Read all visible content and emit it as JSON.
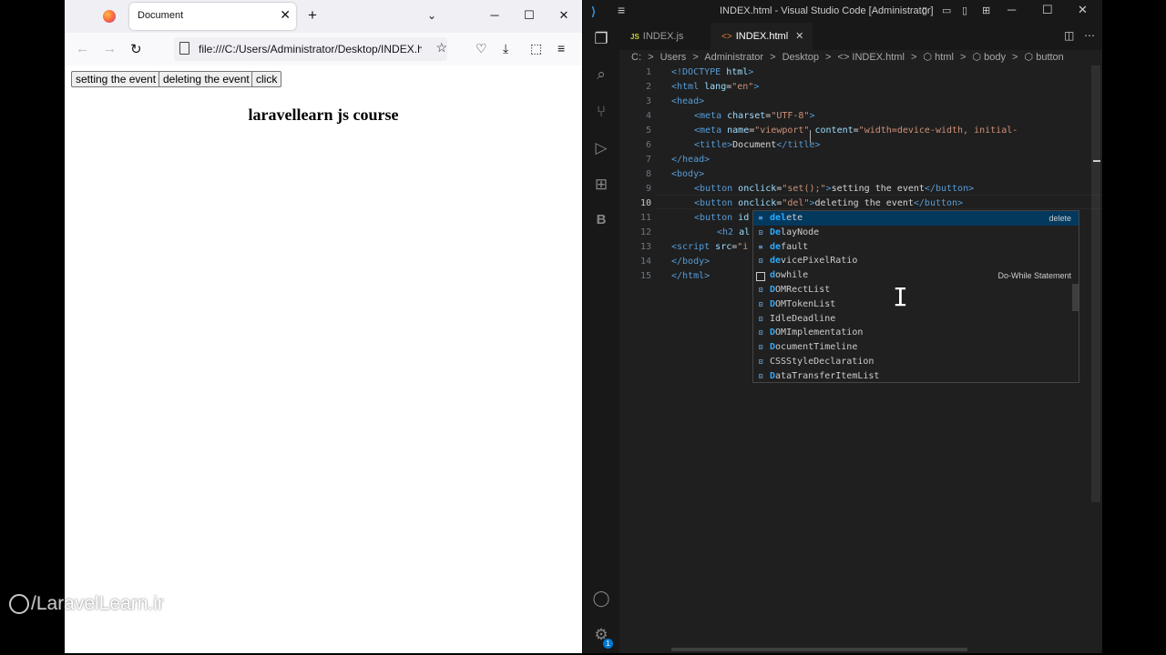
{
  "firefox": {
    "tab_title": "Document",
    "tab_close": "✕",
    "new_tab": "+",
    "all_tabs": "⌄",
    "window_controls": {
      "minimize": "─",
      "maximize": "☐",
      "close": "✕"
    },
    "nav": {
      "back": "←",
      "forward": "→",
      "reload": "↻"
    },
    "url": "file:///C:/Users/Administrator/Desktop/INDEX.html",
    "star": "☆",
    "toolbar_icons": {
      "pocket": "♡",
      "downloads": "⤓",
      "extensions": "⬚",
      "menu": "≡"
    }
  },
  "page": {
    "buttons": [
      "setting the event",
      "deleting the event",
      "click"
    ],
    "heading": "laravellearn js course"
  },
  "watermark": "/LaravelLearn.ir",
  "vscode": {
    "title": "INDEX.html - Visual Studio Code [Administrator]",
    "menu_icon": "≡",
    "logo": "⟩",
    "window_controls": {
      "minimize": "─",
      "maximize": "☐",
      "close": "✕"
    },
    "tabs": [
      {
        "badge": "JS",
        "label": "INDEX.js"
      },
      {
        "badge": "<>",
        "label": "INDEX.html",
        "close": "✕"
      }
    ],
    "breadcrumb": [
      "C:",
      ">",
      "Users",
      ">",
      "Administrator",
      ">",
      "Desktop",
      ">",
      "<> INDEX.html",
      ">",
      "⬡ html",
      ">",
      "⬡ body",
      ">",
      "⬡ button"
    ],
    "activity_icons": {
      "explorer": "❐",
      "search": "⌕",
      "scm": "⑂",
      "run": "▷",
      "extensions": "⊞",
      "blackbox": "B",
      "accounts": "◯",
      "settings": "⚙"
    },
    "settings_badge": "1",
    "line_numbers": [
      "1",
      "2",
      "3",
      "4",
      "5",
      "6",
      "7",
      "8",
      "9",
      "10",
      "11",
      "12",
      "13",
      "14",
      "15"
    ],
    "current_line": "10",
    "code": {
      "l1": [
        "<!DOCTYPE",
        " html",
        ">"
      ],
      "l2": [
        "<html",
        " lang",
        "=",
        "\"en\"",
        ">"
      ],
      "l3": [
        "<head>"
      ],
      "l4": [
        "<meta",
        " charset",
        "=",
        "\"UTF-8\"",
        ">"
      ],
      "l5": [
        "<meta",
        " name",
        "=",
        "\"viewport\"",
        " content",
        "=",
        "\"width=device-width, initial-"
      ],
      "l6": [
        "<title>",
        "Document",
        "</title>"
      ],
      "l7": [
        "</head>"
      ],
      "l8": [
        "<body>"
      ],
      "l9": [
        "<button",
        " onclick",
        "=",
        "\"set();\"",
        ">",
        "setting the event",
        "</button>"
      ],
      "l10": [
        "<button",
        " onclick",
        "=",
        "\"del",
        "\"",
        ">",
        "deleting the event",
        "</button>"
      ],
      "l11": [
        "<button",
        " id"
      ],
      "l12": [
        "<h2",
        " al"
      ],
      "l13": [
        "<script",
        " src",
        "=",
        "\"i"
      ],
      "l14": [
        "</body>"
      ],
      "l15": [
        "</html>"
      ]
    },
    "suggestions": [
      {
        "icon": "keyword",
        "hl": "del",
        "rest": "ete",
        "detail": "delete"
      },
      {
        "icon": "variable",
        "hl": "De",
        "rest": "layNode",
        "detail": ""
      },
      {
        "icon": "keyword",
        "hl": "de",
        "rest": "fault",
        "detail": ""
      },
      {
        "icon": "variable",
        "hl": "de",
        "rest": "vicePixelRatio",
        "detail": ""
      },
      {
        "icon": "snippet",
        "hl": "d",
        "rest": "owhile",
        "detail": "Do-While Statement"
      },
      {
        "icon": "variable",
        "hl": "D",
        "rest": "OMRectList",
        "detail": ""
      },
      {
        "icon": "variable",
        "hl": "D",
        "rest": "OMTokenList",
        "detail": ""
      },
      {
        "icon": "variable",
        "hl": "",
        "rest": "IdleDeadline",
        "detail": ""
      },
      {
        "icon": "variable",
        "hl": "D",
        "rest": "OMImplementation",
        "detail": ""
      },
      {
        "icon": "variable",
        "hl": "D",
        "rest": "ocumentTimeline",
        "detail": ""
      },
      {
        "icon": "variable",
        "hl": "",
        "rest": "CSSStyleDeclaration",
        "detail": ""
      },
      {
        "icon": "variable",
        "hl": "D",
        "rest": "ataTransferItemList",
        "detail": ""
      }
    ]
  },
  "icon_names": [
    "firefox-logo",
    "back-icon",
    "forward-icon",
    "reload-icon",
    "star-icon",
    "vscode-logo",
    "explorer-icon",
    "search-icon",
    "source-control-icon",
    "run-debug-icon",
    "extensions-icon",
    "accounts-icon",
    "settings-icon",
    "mouse-ibeam-cursor"
  ]
}
